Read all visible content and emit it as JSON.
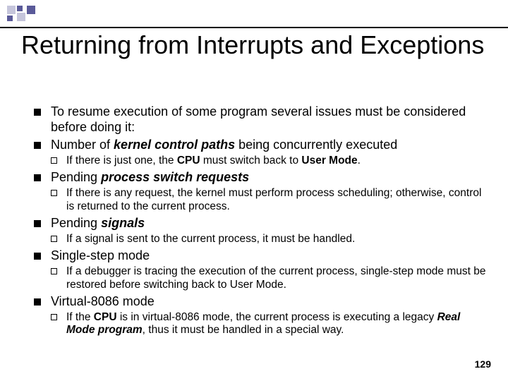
{
  "title": "Returning from Interrupts and Exceptions",
  "bullets": {
    "b1": "To resume execution of some program several issues must be considered before doing it:",
    "b2_pre": "Number of ",
    "b2_em": "kernel control paths",
    "b2_post": " being concurrently executed",
    "b2_sub_pre": "If there is just one, the ",
    "b2_sub_b1": "CPU",
    "b2_sub_mid": " must switch back to ",
    "b2_sub_b2": "User Mode",
    "b2_sub_post": ".",
    "b3_pre": "Pending ",
    "b3_em": "process switch requests",
    "b3_sub": "If there is any request, the kernel must perform process scheduling; otherwise, control is returned to the current process.",
    "b4_pre": "Pending ",
    "b4_em": "signals",
    "b4_sub": "If a signal is sent to the current process, it must be handled.",
    "b5": "Single-step mode",
    "b5_sub": "If a debugger is tracing the execution of the current process, single-step mode must be restored before switching back to User Mode.",
    "b6": "Virtual-8086 mode",
    "b6_sub_pre": "If the ",
    "b6_sub_b1": "CPU",
    "b6_sub_mid": " is in virtual-8086 mode, the current process is executing a legacy ",
    "b6_sub_em": "Real Mode program",
    "b6_sub_post": ", thus it must be handled in a special way."
  },
  "page_number": "129"
}
